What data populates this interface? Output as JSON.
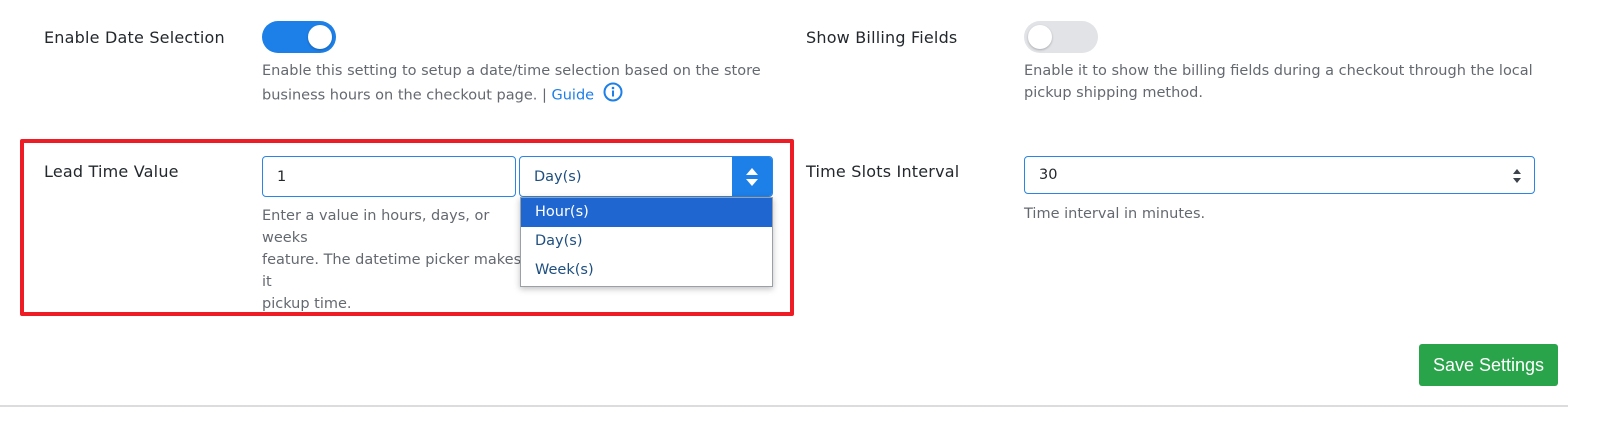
{
  "date_selection": {
    "label": "Enable Date Selection",
    "enabled": true,
    "desc_line1": "Enable this setting to setup a date/time selection based on the store",
    "desc_line2": "business hours on the checkout page. |",
    "guide_link": "Guide",
    "info_icon": "info-circle-icon"
  },
  "billing_fields": {
    "label": "Show Billing Fields",
    "enabled": false,
    "desc_line1": "Enable it to show the billing fields during a checkout through the local",
    "desc_line2": "pickup shipping method."
  },
  "lead_time": {
    "label": "Lead Time Value",
    "value": "1",
    "unit_selected": "Day(s)",
    "unit_options": [
      "Hour(s)",
      "Day(s)",
      "Week(s)"
    ],
    "highlighted_option": "Hour(s)",
    "desc_line1": "Enter a value in hours, days, or weeks",
    "desc_line2": "feature. The datetime picker makes it",
    "desc_line3": "pickup time."
  },
  "time_slots": {
    "label": "Time Slots Interval",
    "value": "30",
    "desc": "Time interval in minutes."
  },
  "actions": {
    "save_label": "Save Settings"
  },
  "colors": {
    "accent": "#1d7fe8",
    "save_button": "#2aa44a",
    "highlight_border": "#ee1c24"
  }
}
